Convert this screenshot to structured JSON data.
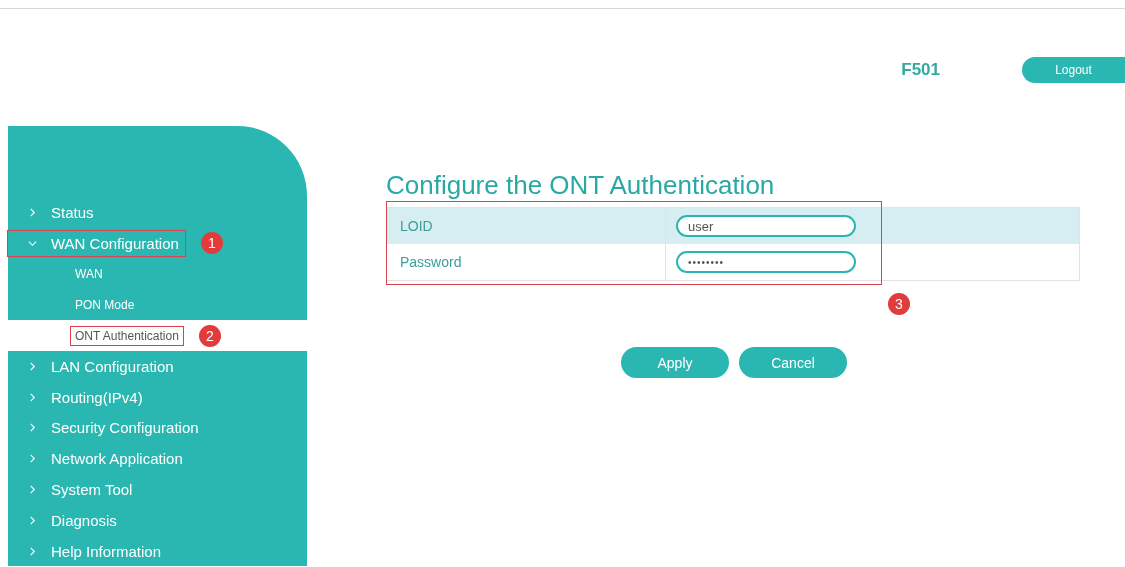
{
  "header": {
    "device": "F501",
    "logout": "Logout"
  },
  "sidebar": {
    "items": [
      {
        "label": "Status",
        "expanded": false
      },
      {
        "label": "WAN Configuration",
        "expanded": true,
        "annotation": "1",
        "children": [
          {
            "label": "WAN",
            "selected": false
          },
          {
            "label": "PON Mode",
            "selected": false
          },
          {
            "label": "ONT Authentication",
            "selected": true,
            "annotation": "2"
          }
        ]
      },
      {
        "label": "LAN Configuration",
        "expanded": false
      },
      {
        "label": "Routing(IPv4)",
        "expanded": false
      },
      {
        "label": "Security Configuration",
        "expanded": false
      },
      {
        "label": "Network Application",
        "expanded": false
      },
      {
        "label": "System Tool",
        "expanded": false
      },
      {
        "label": "Diagnosis",
        "expanded": false
      },
      {
        "label": "Help Information",
        "expanded": false
      }
    ]
  },
  "main": {
    "title": "Configure the ONT Authentication",
    "form": {
      "annotation": "3",
      "fields": [
        {
          "label": "LOID",
          "value": "user",
          "kind": "text"
        },
        {
          "label": "Password",
          "value": "••••••••",
          "kind": "password"
        }
      ]
    },
    "buttons": [
      "Apply",
      "Cancel"
    ]
  }
}
